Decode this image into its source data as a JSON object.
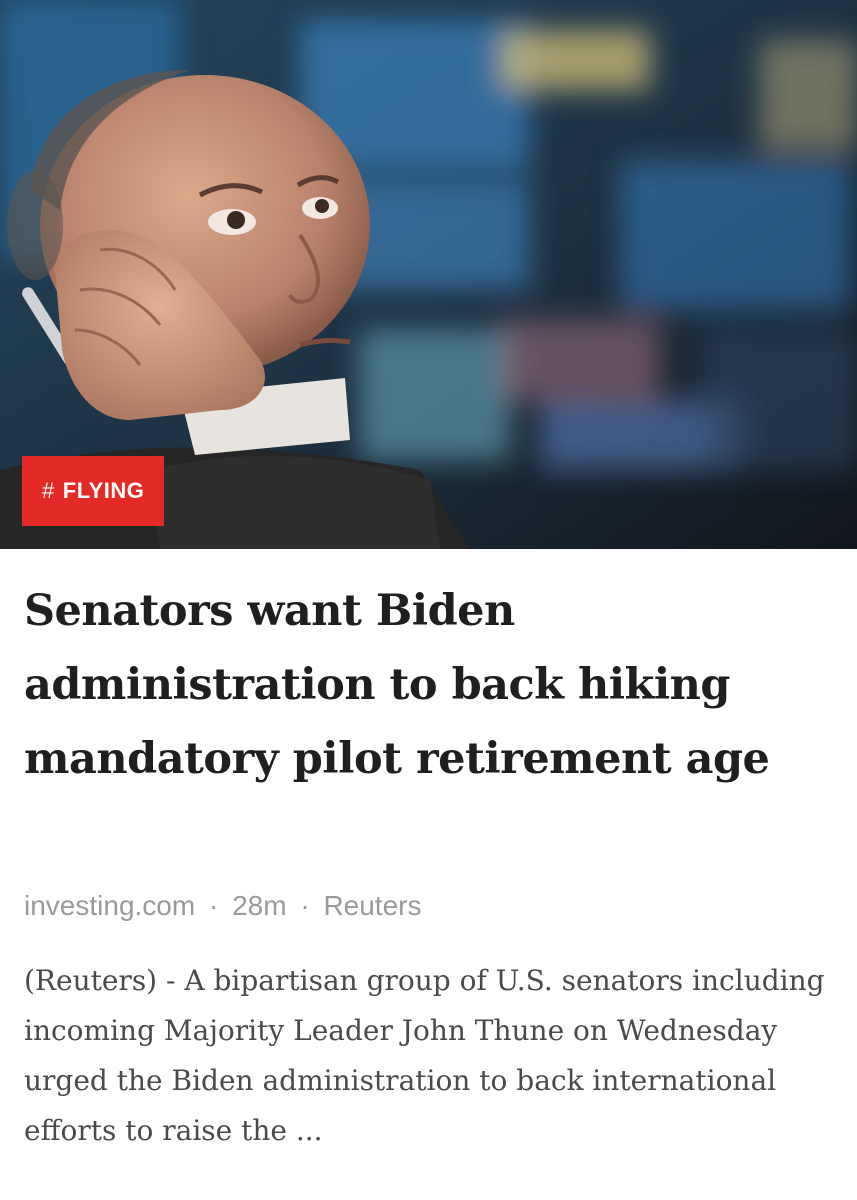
{
  "article": {
    "image_alt": "Trader on the phone looking up",
    "tag": {
      "hash": "#",
      "label": "FLYING",
      "color": "#e42a26"
    },
    "headline": "Senators want Biden administration to back hiking mandatory pilot retirement age",
    "meta": {
      "source": "investing.com",
      "separator": "·",
      "time": "28m",
      "author": "Reuters"
    },
    "summary": "(Reuters) - A bipartisan group of U.S. senators including incoming Majority Leader John Thune on Wednesday urged the Biden administration to back international efforts to raise the ..."
  }
}
